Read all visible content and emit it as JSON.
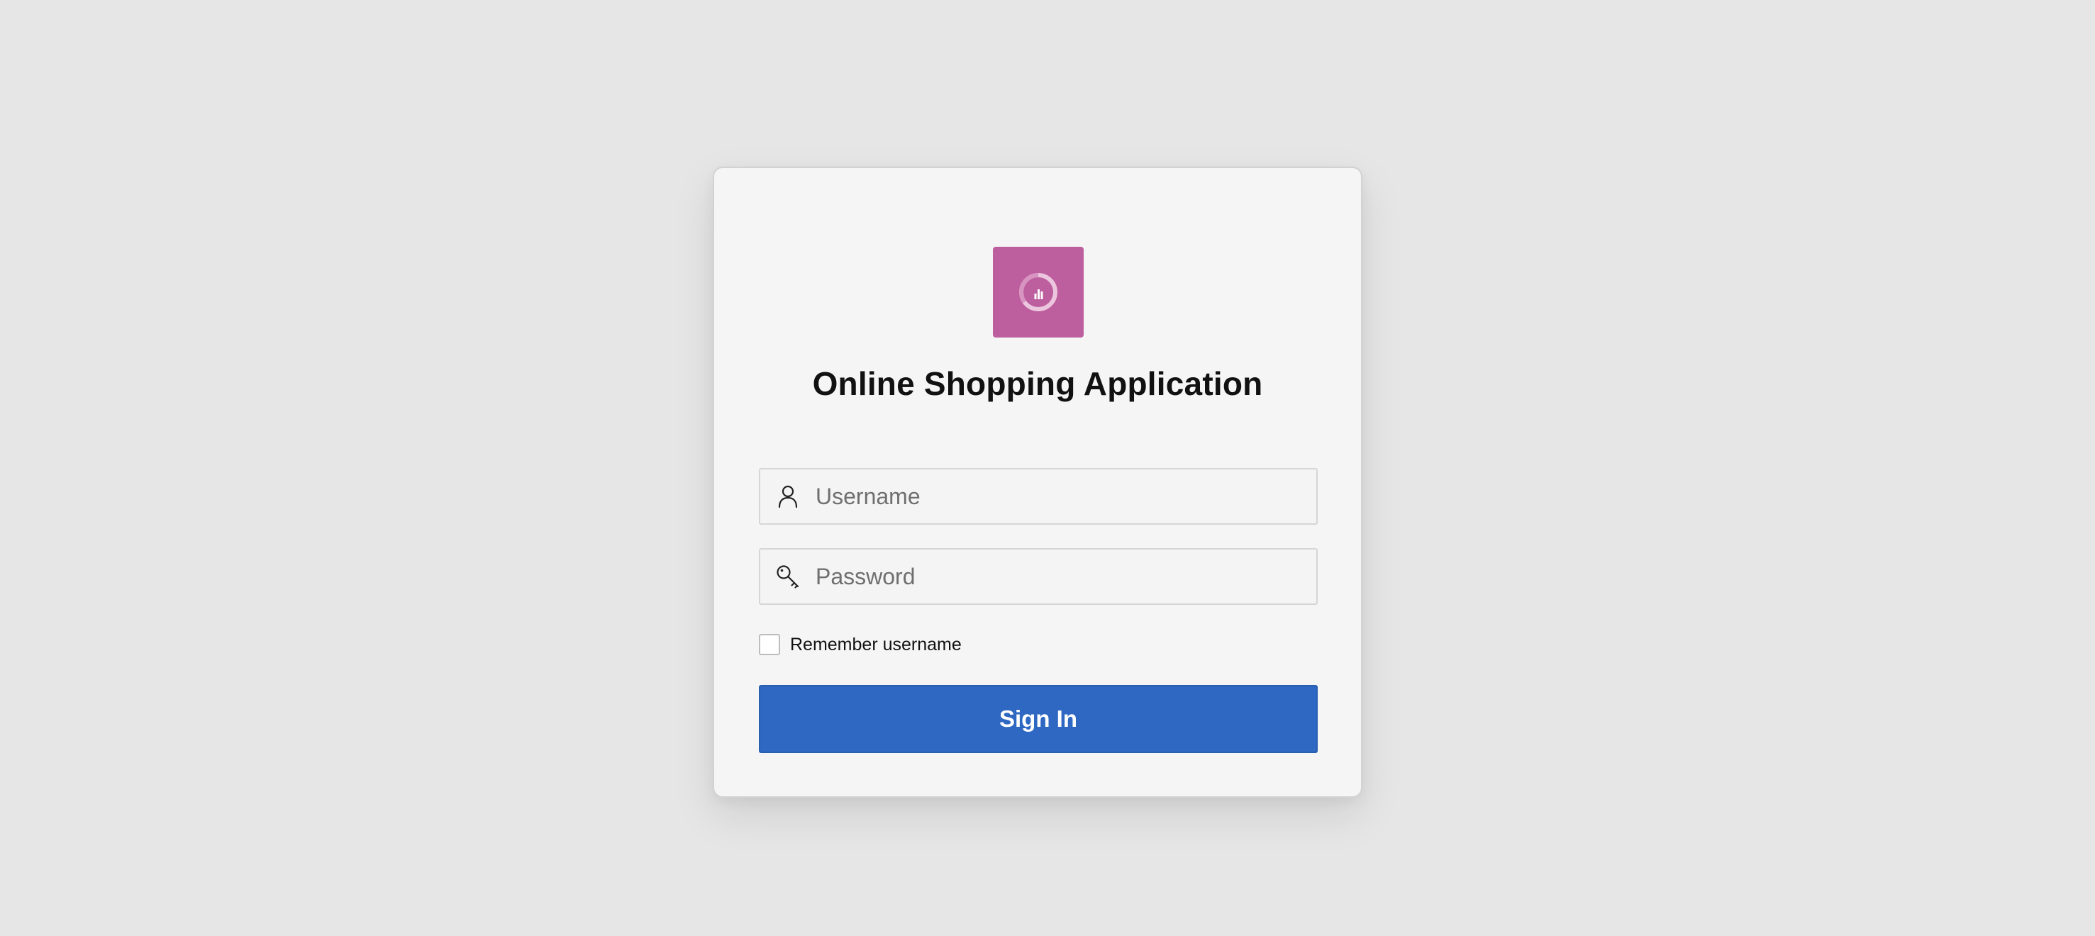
{
  "app": {
    "title": "Online Shopping Application",
    "logo_icon": "donut-chart-icon",
    "logo_color": "#bd5e9e"
  },
  "form": {
    "username": {
      "placeholder": "Username",
      "value": "",
      "icon": "user-icon"
    },
    "password": {
      "placeholder": "Password",
      "value": "",
      "icon": "key-icon"
    },
    "remember": {
      "label": "Remember username",
      "checked": false
    },
    "submit": {
      "label": "Sign In",
      "color": "#2e68c2"
    }
  }
}
